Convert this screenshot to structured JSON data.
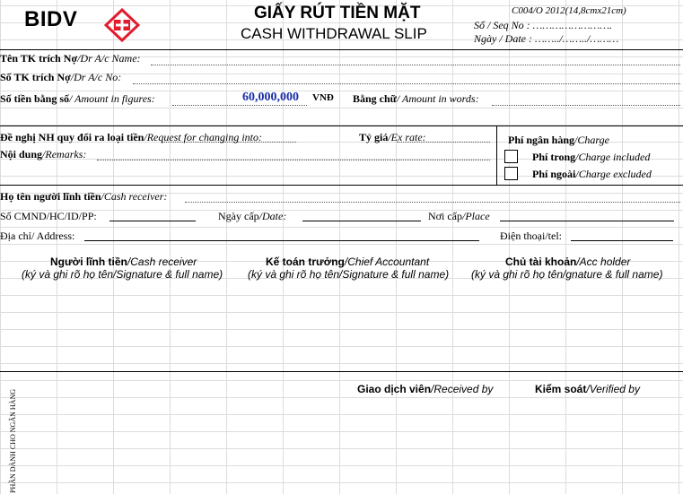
{
  "header": {
    "bank_name": "BIDV",
    "title_vn": "GIẤY RÚT TIỀN MẶT",
    "title_en": "CASH WITHDRAWAL SLIP",
    "form_code": "C004/O 2012(14,8cmx21cm)",
    "seq_no": "Số / Seq No : …………………….",
    "date": "Ngày / Date : ……../……../………"
  },
  "fields": {
    "account_name": {
      "label": "Tên TK trích Nợ",
      "label_en": "/Dr A/c Name:"
    },
    "account_no": {
      "label": "Số TK trích Nợ",
      "label_en": "/Dr A/c No:"
    },
    "amount_figures": {
      "label": "Số tiền bằng  số",
      "label_en": "/ Amount in figures:",
      "value": "60,000,000",
      "currency": "VNĐ"
    },
    "amount_words": {
      "label": "Bằng chữ",
      "label_en": "/ Amount in words:"
    },
    "exchange_request": {
      "label": "Đề nghị NH quy đổi ra loại tiền",
      "label_en": "/Request for changing into:"
    },
    "exchange_rate": {
      "label": "Tỷ giá",
      "label_en": "/Ex rate:"
    },
    "remarks": {
      "label": "Nội dung",
      "label_en": "/Remarks:"
    },
    "receiver_name": {
      "label": "Họ tên người lĩnh tiền",
      "label_en": "/Cash receiver:"
    },
    "id_no": {
      "label": "Số CMND/HC/ID/PP:"
    },
    "issue_date": {
      "label": "Ngày cấp",
      "label_en": "/Date:"
    },
    "issue_place": {
      "label": "Nơi cấp",
      "label_en": "/Place"
    },
    "address": {
      "label": "Địa chỉ/ Address:"
    },
    "phone": {
      "label": "Điện thoại/tel:"
    }
  },
  "charges": {
    "title": "Phí ngân hàng",
    "title_en": "/Charge",
    "included": {
      "label": "Phí trong",
      "label_en": "/Charge included",
      "checked": false
    },
    "excluded": {
      "label": "Phí ngoài",
      "label_en": "/Charge excluded",
      "checked": false
    }
  },
  "signatures": {
    "receiver": {
      "label": "Người lĩnh tiền",
      "label_en": "/Cash receiver",
      "note": "(ký và ghi rõ họ tên/Signature & full name)"
    },
    "chief_accountant": {
      "label": "Kế toán trưởng",
      "label_en": "/Chief Accountant",
      "note": "(ký và ghi rõ họ tên/Signature & full name)"
    },
    "acc_holder": {
      "label": "Chủ tài khoản",
      "label_en": "/Acc holder",
      "note": "(ký và ghi rõ họ tên/gnature & full name)"
    }
  },
  "bank_section": {
    "side_label": "PHẦN DÀNH CHO NGÂN HÀNG",
    "teller": {
      "label": "Giao dịch viên",
      "label_en": "/Received by"
    },
    "verifier": {
      "label": "Kiểm soát",
      "label_en": "/Verified by"
    }
  },
  "colors": {
    "amount_value": "#1a2ea8",
    "logo_red": "#e21b2d"
  }
}
